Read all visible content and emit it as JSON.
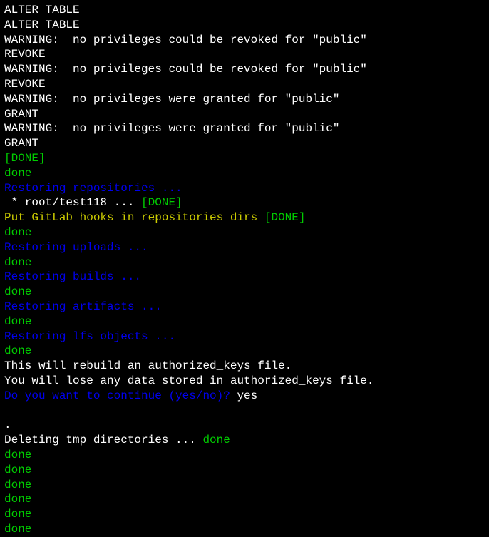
{
  "lines": [
    {
      "segments": [
        {
          "text": "ALTER TABLE",
          "color": "white"
        }
      ]
    },
    {
      "segments": [
        {
          "text": "ALTER TABLE",
          "color": "white"
        }
      ]
    },
    {
      "segments": [
        {
          "text": "WARNING:  no privileges could be revoked for \"public\"",
          "color": "white"
        }
      ]
    },
    {
      "segments": [
        {
          "text": "REVOKE",
          "color": "white"
        }
      ]
    },
    {
      "segments": [
        {
          "text": "WARNING:  no privileges could be revoked for \"public\"",
          "color": "white"
        }
      ]
    },
    {
      "segments": [
        {
          "text": "REVOKE",
          "color": "white"
        }
      ]
    },
    {
      "segments": [
        {
          "text": "WARNING:  no privileges were granted for \"public\"",
          "color": "white"
        }
      ]
    },
    {
      "segments": [
        {
          "text": "GRANT",
          "color": "white"
        }
      ]
    },
    {
      "segments": [
        {
          "text": "WARNING:  no privileges were granted for \"public\"",
          "color": "white"
        }
      ]
    },
    {
      "segments": [
        {
          "text": "GRANT",
          "color": "white"
        }
      ]
    },
    {
      "segments": [
        {
          "text": "[DONE]",
          "color": "green"
        }
      ]
    },
    {
      "segments": [
        {
          "text": "done",
          "color": "green"
        }
      ]
    },
    {
      "segments": [
        {
          "text": "Restoring repositories ...",
          "color": "blue"
        }
      ]
    },
    {
      "segments": [
        {
          "text": " * root/test118 ... ",
          "color": "white"
        },
        {
          "text": "[DONE]",
          "color": "green"
        }
      ]
    },
    {
      "segments": [
        {
          "text": "Put GitLab hooks in repositories dirs ",
          "color": "yellow"
        },
        {
          "text": "[DONE]",
          "color": "green"
        }
      ]
    },
    {
      "segments": [
        {
          "text": "done",
          "color": "green"
        }
      ]
    },
    {
      "segments": [
        {
          "text": "Restoring uploads ...",
          "color": "blue"
        }
      ]
    },
    {
      "segments": [
        {
          "text": "done",
          "color": "green"
        }
      ]
    },
    {
      "segments": [
        {
          "text": "Restoring builds ...",
          "color": "blue"
        }
      ]
    },
    {
      "segments": [
        {
          "text": "done",
          "color": "green"
        }
      ]
    },
    {
      "segments": [
        {
          "text": "Restoring artifacts ...",
          "color": "blue"
        }
      ]
    },
    {
      "segments": [
        {
          "text": "done",
          "color": "green"
        }
      ]
    },
    {
      "segments": [
        {
          "text": "Restoring lfs objects ...",
          "color": "blue"
        }
      ]
    },
    {
      "segments": [
        {
          "text": "done",
          "color": "green"
        }
      ]
    },
    {
      "segments": [
        {
          "text": "This will rebuild an authorized_keys file.",
          "color": "white"
        }
      ]
    },
    {
      "segments": [
        {
          "text": "You will lose any data stored in authorized_keys file.",
          "color": "white"
        }
      ]
    },
    {
      "segments": [
        {
          "text": "Do you want to continue (yes/no)? ",
          "color": "blue"
        },
        {
          "text": "yes",
          "color": "white"
        }
      ]
    },
    {
      "segments": [
        {
          "text": " ",
          "color": "white"
        }
      ]
    },
    {
      "segments": [
        {
          "text": ".",
          "color": "white"
        }
      ]
    },
    {
      "segments": [
        {
          "text": "Deleting tmp directories ... ",
          "color": "white"
        },
        {
          "text": "done",
          "color": "green"
        }
      ]
    },
    {
      "segments": [
        {
          "text": "done",
          "color": "green"
        }
      ]
    },
    {
      "segments": [
        {
          "text": "done",
          "color": "green"
        }
      ]
    },
    {
      "segments": [
        {
          "text": "done",
          "color": "green"
        }
      ]
    },
    {
      "segments": [
        {
          "text": "done",
          "color": "green"
        }
      ]
    },
    {
      "segments": [
        {
          "text": "done",
          "color": "green"
        }
      ]
    },
    {
      "segments": [
        {
          "text": "done",
          "color": "green"
        }
      ]
    }
  ]
}
